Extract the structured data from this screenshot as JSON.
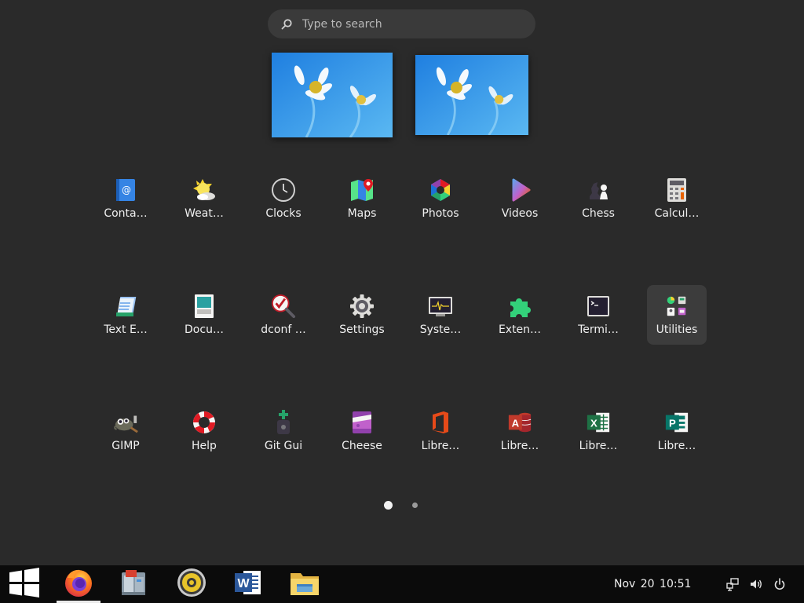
{
  "search": {
    "placeholder": "Type to search",
    "icon": "search-icon"
  },
  "workspaces": [
    {
      "name": "workspace-1",
      "wallpaper": "daisies"
    },
    {
      "name": "workspace-2",
      "wallpaper": "daisies"
    }
  ],
  "apps": [
    {
      "label": "Conta…",
      "icon": "contacts-icon"
    },
    {
      "label": "Weat…",
      "icon": "weather-icon"
    },
    {
      "label": "Clocks",
      "icon": "clocks-icon"
    },
    {
      "label": "Maps",
      "icon": "maps-icon"
    },
    {
      "label": "Photos",
      "icon": "photos-icon"
    },
    {
      "label": "Videos",
      "icon": "videos-icon"
    },
    {
      "label": "Chess",
      "icon": "chess-icon"
    },
    {
      "label": "Calcul…",
      "icon": "calculator-icon"
    },
    {
      "label": "Text E…",
      "icon": "text-editor-icon"
    },
    {
      "label": "Docu…",
      "icon": "document-viewer-icon"
    },
    {
      "label": "dconf …",
      "icon": "dconf-editor-icon"
    },
    {
      "label": "Settings",
      "icon": "settings-icon"
    },
    {
      "label": "Syste…",
      "icon": "system-monitor-icon"
    },
    {
      "label": "Exten…",
      "icon": "extensions-icon"
    },
    {
      "label": "Termi…",
      "icon": "terminal-icon"
    },
    {
      "label": "Utilities",
      "icon": "utilities-folder-icon",
      "selected": true
    },
    {
      "label": "GIMP",
      "icon": "gimp-icon"
    },
    {
      "label": "Help",
      "icon": "help-icon"
    },
    {
      "label": "Git Gui",
      "icon": "git-gui-icon"
    },
    {
      "label": "Cheese",
      "icon": "cheese-icon"
    },
    {
      "label": "Libre…",
      "icon": "office-icon"
    },
    {
      "label": "Libre…",
      "icon": "access-icon"
    },
    {
      "label": "Libre…",
      "icon": "excel-icon"
    },
    {
      "label": "Libre…",
      "icon": "publisher-icon"
    }
  ],
  "pagination": {
    "page_count": 2,
    "current_page": 1
  },
  "taskbar": {
    "items": [
      {
        "icon": "windows-start-icon",
        "active": false
      },
      {
        "icon": "firefox-icon",
        "active": true
      },
      {
        "icon": "file-cabinet-icon",
        "active": false
      },
      {
        "icon": "audio-player-icon",
        "active": false
      },
      {
        "icon": "word-icon",
        "active": false
      },
      {
        "icon": "file-explorer-icon",
        "active": false
      }
    ],
    "date": "Nov 20",
    "time": "10:51",
    "tray": [
      "network-icon",
      "volume-icon",
      "power-icon"
    ]
  },
  "colors": {
    "background": "#2a2a2a",
    "taskbar": "#0b0b0b",
    "accent": "#e6e6e6"
  }
}
